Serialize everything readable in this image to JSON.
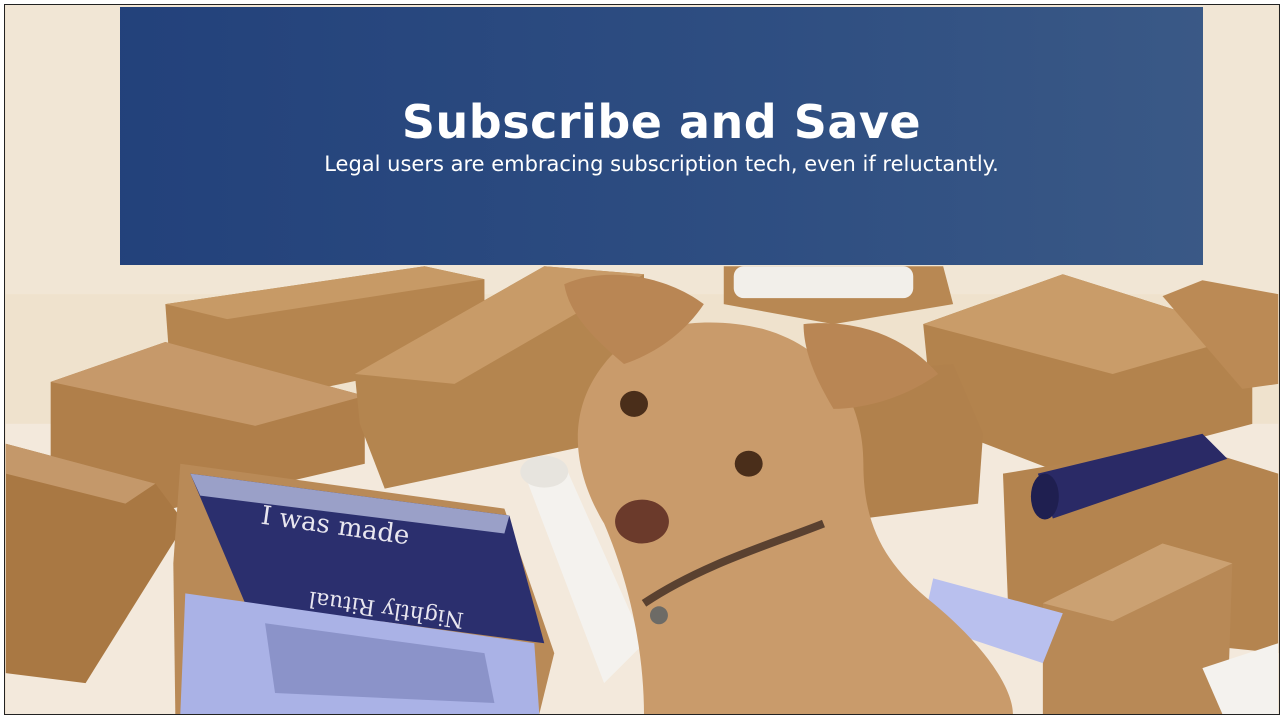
{
  "slide": {
    "title": "Subscribe and Save",
    "subtitle": "Legal users are embracing subscription tech, even if reluctantly."
  },
  "photo": {
    "description_icon": "dog-with-subscription-boxes-photo",
    "box_print_line1": "I was made",
    "box_print_brand": "Nightly Ritual"
  },
  "colors": {
    "banner": "#1f427a",
    "cardboard": "#b98a57",
    "background": "#efe1cc",
    "dog_fur": "#c89a6a",
    "insert_navy": "#2b2f6e",
    "lavender": "#b9c0ee"
  }
}
